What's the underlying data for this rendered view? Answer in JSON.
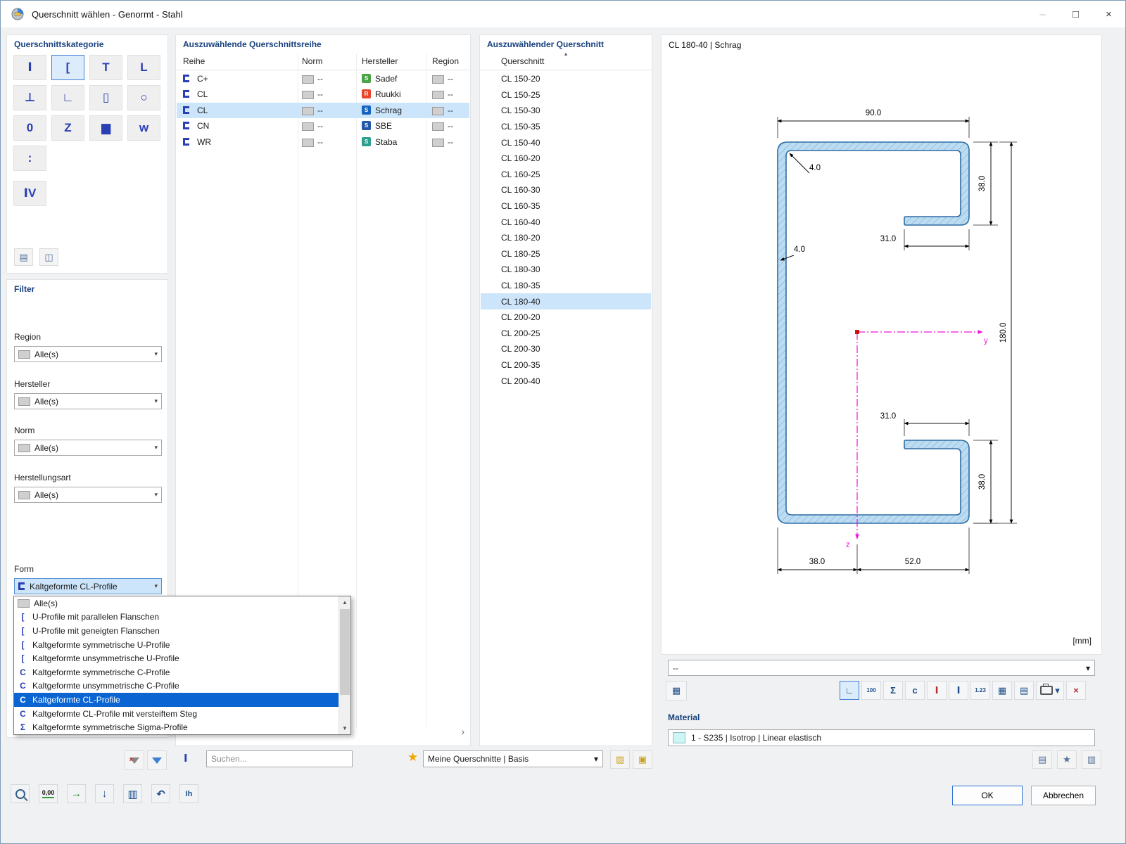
{
  "window": {
    "title": "Querschnitt wählen - Genormt - Stahl",
    "minimize_glyph": "–",
    "maximize_glyph": "□",
    "close_glyph": "×"
  },
  "ui": {
    "chevron": "▾",
    "scroll_up": "▲",
    "scroll_down": "▼",
    "scroll_right": "›"
  },
  "colors": {
    "accent_blue": "#2a6fd3",
    "selection_light_blue": "#cde5fb",
    "dropdown_selection_blue": "#0a64d2",
    "panel_header_navy": "#17417e",
    "category_glyph_blue": "#2b3fb5",
    "axis_magenta": "#f013dc",
    "centroid_red": "#cc1111",
    "section_fill_blue": "#bcdcf2",
    "section_stroke_blue": "#2e6da4",
    "material_swatch_cyan": "#ccf6f6"
  },
  "category_panel": {
    "title": "Querschnittskategorie",
    "buttons": [
      {
        "glyph": "Ⅰ"
      },
      {
        "glyph": "[",
        "selected": true
      },
      {
        "glyph": "T"
      },
      {
        "glyph": "L"
      },
      {
        "glyph": "⊥"
      },
      {
        "glyph": "∟"
      },
      {
        "glyph": "▯"
      },
      {
        "glyph": "○"
      },
      {
        "glyph": "0"
      },
      {
        "glyph": "Z"
      },
      {
        "glyph": "▆"
      },
      {
        "glyph": "w"
      },
      {
        "glyph": ":"
      },
      {
        "glyph": "ⅠV"
      }
    ],
    "footer_buttons": [
      {
        "glyph": "▤"
      },
      {
        "glyph": "◫"
      }
    ]
  },
  "filter_panel": {
    "title": "Filter",
    "region_label": "Region",
    "region_value": "Alle(s)",
    "hersteller_label": "Hersteller",
    "hersteller_value": "Alle(s)",
    "norm_label": "Norm",
    "norm_value": "Alle(s)",
    "herstellungsart_label": "Herstellungsart",
    "herstellungsart_value": "Alle(s)",
    "form_label": "Form",
    "form_value": "Kaltgeformte CL-Profile",
    "form_options": [
      {
        "label": "Alle(s)",
        "icon": ""
      },
      {
        "label": "U-Profile mit parallelen Flanschen",
        "icon": "["
      },
      {
        "label": "U-Profile mit geneigten Flanschen",
        "icon": "["
      },
      {
        "label": "Kaltgeformte symmetrische U-Profile",
        "icon": "["
      },
      {
        "label": "Kaltgeformte unsymmetrische U-Profile",
        "icon": "["
      },
      {
        "label": "Kaltgeformte symmetrische C-Profile",
        "icon": "C"
      },
      {
        "label": "Kaltgeformte unsymmetrische C-Profile",
        "icon": "C"
      },
      {
        "label": "Kaltgeformte CL-Profile",
        "icon": "C",
        "selected": true
      },
      {
        "label": "Kaltgeformte CL-Profile mit versteiftem Steg",
        "icon": "C"
      },
      {
        "label": "Kaltgeformte symmetrische Sigma-Profile",
        "icon": "Σ"
      }
    ]
  },
  "series_panel": {
    "title": "Auszuwählende Querschnittsreihe",
    "columns": {
      "reihe": "Reihe",
      "norm": "Norm",
      "hersteller": "Hersteller",
      "region": "Region"
    },
    "rows": [
      {
        "reihe": "C+",
        "norm": "--",
        "hersteller": "Sadef",
        "region": "--",
        "brand_letter": "S",
        "brand_style": "background:#4aa546"
      },
      {
        "reihe": "CL",
        "norm": "--",
        "hersteller": "Ruukki",
        "region": "--",
        "brand_letter": "R",
        "brand_style": "background:#e8452c"
      },
      {
        "reihe": "CL",
        "norm": "--",
        "hersteller": "Schrag",
        "region": "--",
        "brand_letter": "S",
        "brand_style": "background:#1565c0",
        "selected": true
      },
      {
        "reihe": "CN",
        "norm": "--",
        "hersteller": "SBE",
        "region": "--",
        "brand_letter": "S",
        "brand_style": "background:#2458a8"
      },
      {
        "reihe": "WR",
        "norm": "--",
        "hersteller": "Staba",
        "region": "--",
        "brand_letter": "S",
        "brand_style": "background:#2e9e8f"
      }
    ],
    "search_placeholder": "Suchen..."
  },
  "section_panel": {
    "title": "Auszuwählender Querschnitt",
    "sort_glyph": "▴",
    "column_header": "Querschnitt",
    "items": [
      "CL 150-20",
      "CL 150-25",
      "CL 150-30",
      "CL 150-35",
      "CL 150-40",
      "CL 160-20",
      "CL 160-25",
      "CL 160-30",
      "CL 160-35",
      "CL 160-40",
      "CL 180-20",
      "CL 180-25",
      "CL 180-30",
      "CL 180-35",
      "CL 180-40",
      "CL 200-20",
      "CL 200-25",
      "CL 200-30",
      "CL 200-35",
      "CL 200-40"
    ],
    "selected_item": "CL 180-40"
  },
  "preview": {
    "caption": "CL 180-40 | Schrag",
    "unit": "[mm]",
    "comment_value": "--",
    "dims": {
      "top_width": "90.0",
      "top_lip": "38.0",
      "thickness_top": "4.0",
      "top_return": "31.0",
      "thickness_web": "4.0",
      "height": "180.0",
      "bottom_return": "31.0",
      "bottom_lip": "38.0",
      "bottom_left": "38.0",
      "bottom_right": "52.0"
    },
    "axis_y": "y",
    "axis_z": "z"
  },
  "preview_toolbar": {
    "left_glyph": "▦",
    "buttons": [
      {
        "glyph": "∟",
        "selected": true
      },
      {
        "glyph": "100"
      },
      {
        "glyph": "Σ"
      },
      {
        "glyph": "c"
      },
      {
        "glyph": "Ⅰ"
      },
      {
        "glyph": "Ⅰ"
      },
      {
        "glyph": "1.23"
      },
      {
        "glyph": "▦"
      },
      {
        "glyph": "▤"
      },
      {
        "glyph": ""
      },
      {
        "glyph": "×"
      }
    ]
  },
  "material": {
    "title": "Material",
    "value": "1 - S235 | Isotrop | Linear elastisch",
    "buttons": [
      {
        "glyph": "▤"
      },
      {
        "glyph": "★"
      },
      {
        "glyph": "▥"
      }
    ]
  },
  "bottom_bar": {
    "my_sections_value": "Meine Querschnitte | Basis",
    "ok_label": "OK",
    "cancel_label": "Abbrechen"
  },
  "toolbar_left": {
    "buttons": [
      {
        "glyph": ""
      },
      {
        "glyph": "0,00"
      },
      {
        "glyph": "→"
      },
      {
        "glyph": "↓"
      },
      {
        "glyph": "▥"
      },
      {
        "glyph": "↶"
      },
      {
        "glyph": "Ih"
      }
    ]
  }
}
